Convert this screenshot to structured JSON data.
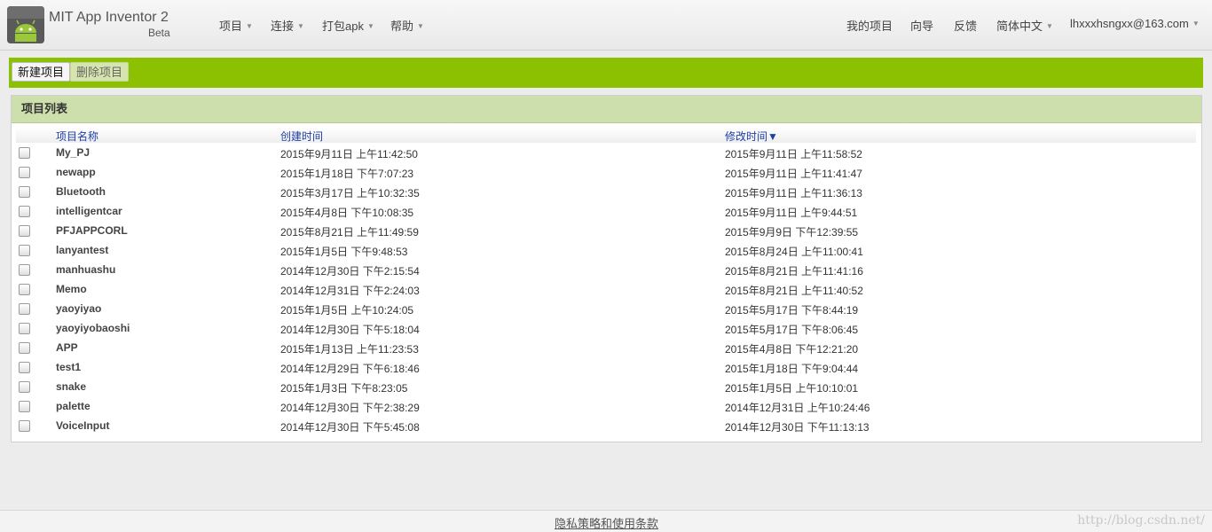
{
  "header": {
    "brand_name": "MIT App Inventor 2",
    "brand_sub": "Beta",
    "nav_left": [
      "项目",
      "连接",
      "打包apk",
      "帮助"
    ],
    "nav_right": [
      "我的项目",
      "向导",
      "反馈",
      "简体中文",
      "lhxxxhsngxx@163.com"
    ]
  },
  "toolbar": {
    "new_label": "新建项目",
    "delete_label": "删除项目"
  },
  "panel": {
    "title": "项目列表",
    "columns": [
      "项目名称",
      "创建时间",
      "修改时间▼"
    ],
    "rows": [
      {
        "name": "My_PJ",
        "created": "2015年9月11日 上午11:42:50",
        "modified": "2015年9月11日 上午11:58:52"
      },
      {
        "name": "newapp",
        "created": "2015年1月18日 下午7:07:23",
        "modified": "2015年9月11日 上午11:41:47"
      },
      {
        "name": "Bluetooth",
        "created": "2015年3月17日 上午10:32:35",
        "modified": "2015年9月11日 上午11:36:13"
      },
      {
        "name": "intelligentcar",
        "created": "2015年4月8日 下午10:08:35",
        "modified": "2015年9月11日 上午9:44:51"
      },
      {
        "name": "PFJAPPCORL",
        "created": "2015年8月21日 上午11:49:59",
        "modified": "2015年9月9日 下午12:39:55"
      },
      {
        "name": "lanyantest",
        "created": "2015年1月5日 下午9:48:53",
        "modified": "2015年8月24日 上午11:00:41"
      },
      {
        "name": "manhuashu",
        "created": "2014年12月30日 下午2:15:54",
        "modified": "2015年8月21日 上午11:41:16"
      },
      {
        "name": "Memo",
        "created": "2014年12月31日 下午2:24:03",
        "modified": "2015年8月21日 上午11:40:52"
      },
      {
        "name": "yaoyiyao",
        "created": "2015年1月5日 上午10:24:05",
        "modified": "2015年5月17日 下午8:44:19"
      },
      {
        "name": "yaoyiyobaoshi",
        "created": "2014年12月30日 下午5:18:04",
        "modified": "2015年5月17日 下午8:06:45"
      },
      {
        "name": "APP",
        "created": "2015年1月13日 上午11:23:53",
        "modified": "2015年4月8日 下午12:21:20"
      },
      {
        "name": "test1",
        "created": "2014年12月29日 下午6:18:46",
        "modified": "2015年1月18日 下午9:04:44"
      },
      {
        "name": "snake",
        "created": "2015年1月3日 下午8:23:05",
        "modified": "2015年1月5日 上午10:10:01"
      },
      {
        "name": "palette",
        "created": "2014年12月30日 下午2:38:29",
        "modified": "2014年12月31日 上午10:24:46"
      },
      {
        "name": "VoiceInput",
        "created": "2014年12月30日 下午5:45:08",
        "modified": "2014年12月30日 下午11:13:13"
      }
    ]
  },
  "footer": {
    "link": "隐私策略和使用条款",
    "watermark": "http://blog.csdn.net/"
  }
}
